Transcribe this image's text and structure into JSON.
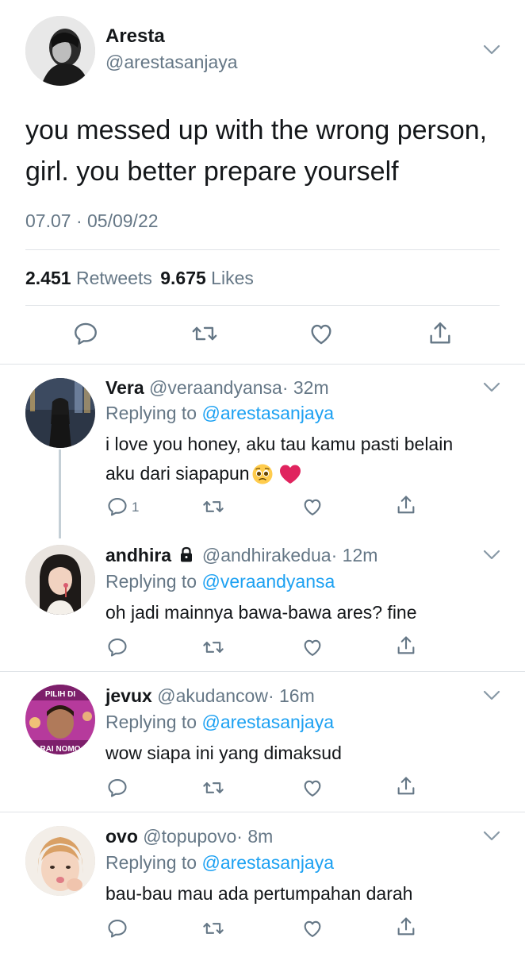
{
  "main_tweet": {
    "name": "Aresta",
    "handle": "@arestasanjaya",
    "text_line1": "you messed up with the wrong person,",
    "text_line2": "girl. you better prepare yourself",
    "timestamp": "07.07 · 05/09/22",
    "retweets_count": "2.451",
    "retweets_label": "Retweets",
    "likes_count": "9.675",
    "likes_label": "Likes"
  },
  "replies": [
    {
      "name": "Vera",
      "handle": "@veraandyansa",
      "time": "· 32m",
      "replying_label": "Replying to",
      "replying_to": "@arestasanjaya",
      "text_line1": "i love you honey, aku tau kamu pasti belain",
      "text_line2": "aku dari siapapun",
      "emoji": "🥺",
      "reply_count": "1"
    },
    {
      "name": "andhira",
      "handle": "@andhirakedua",
      "time": "· 12m",
      "replying_label": "Replying to",
      "replying_to": "@veraandyansa",
      "text_line1": "oh jadi mainnya bawa-bawa ares? fine"
    },
    {
      "name": "jevux",
      "handle": "@akudancow",
      "time": "· 16m",
      "replying_label": "Replying to",
      "replying_to": "@arestasanjaya",
      "text_line1": "wow siapa ini yang dimaksud",
      "avatar_text_top": "PILIH DI",
      "avatar_text_bottom": "RAI NOMO"
    },
    {
      "name": "ovo",
      "handle": "@topupovo",
      "time": "· 8m",
      "replying_label": "Replying to",
      "replying_to": "@arestasanjaya",
      "text_line1": "bau-bau mau ada pertumpahan darah"
    }
  ],
  "colors": {
    "text": "#14171a",
    "secondary": "#657786",
    "link": "#1da1f2",
    "divider": "#dfe3e7",
    "heart_emoji": "#e0245e"
  },
  "icons": [
    "chevron-down-icon",
    "reply-icon",
    "retweet-icon",
    "like-icon",
    "share-icon",
    "lock-icon",
    "pleading-face-emoji",
    "red-heart-emoji"
  ]
}
